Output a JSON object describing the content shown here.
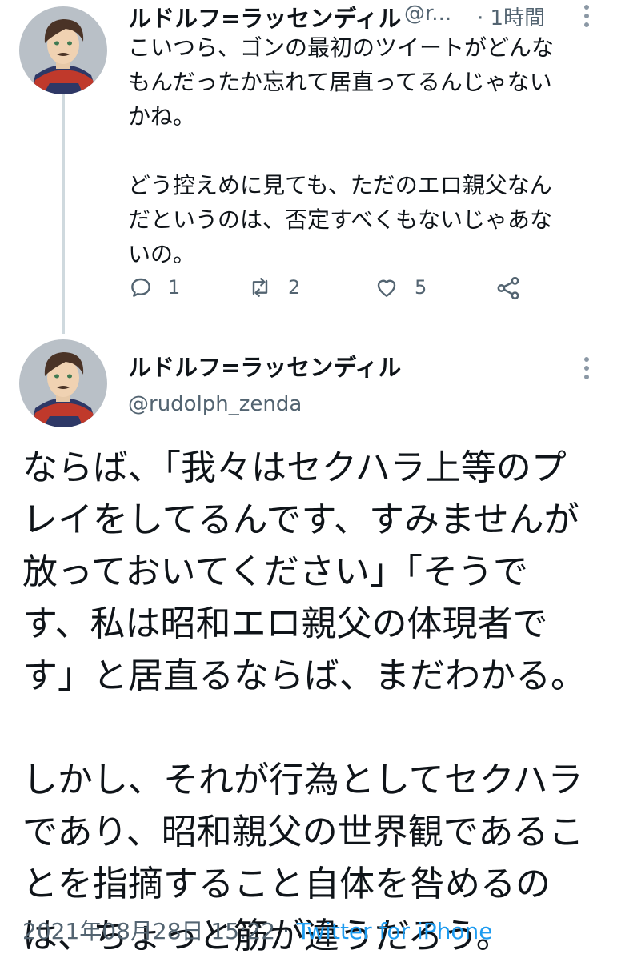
{
  "tweet1": {
    "author_name": "ルドルフ=ラッセンディル",
    "author_handle": "@r...",
    "time": "· 1時間",
    "text": "こいつら、ゴンの最初のツイートがどんな\nもんだったか忘れて居直ってるんじゃない\nかね。\n\nどう控えめに見ても、ただのエロ親父なん\nだというのは、否定すべくもないじゃあな\nいの。",
    "actions": {
      "reply_icon": "reply-icon",
      "reply_count": "1",
      "retweet_icon": "retweet-icon",
      "retweet_count": "2",
      "like_icon": "like-icon",
      "like_count": "5",
      "share_icon": "share-icon"
    }
  },
  "tweet2": {
    "author_name": "ルドルフ=ラッセンディル",
    "author_handle": "@rudolph_zenda",
    "text": "ならば、「我々はセクハラ上等のプ\nレイをしてるんです、すみませんが\n放っておいてください」「そうで\nす、私は昭和エロ親父の体現者で\nす」と居直るならば、まだわかる。\n\nしかし、それが行為としてセクハラ\nであり、昭和親父の世界観であるこ\nとを指摘すること自体を咎めるの\nは、ちょっと筋が違うだろう。",
    "date": "2021年08月28日 15:22 · ",
    "source": "Twitter for iPhone"
  },
  "colors": {
    "text": "#0f1419",
    "secondary": "#536471",
    "link": "#1d9bf0",
    "thread_line": "#cfd9de"
  }
}
